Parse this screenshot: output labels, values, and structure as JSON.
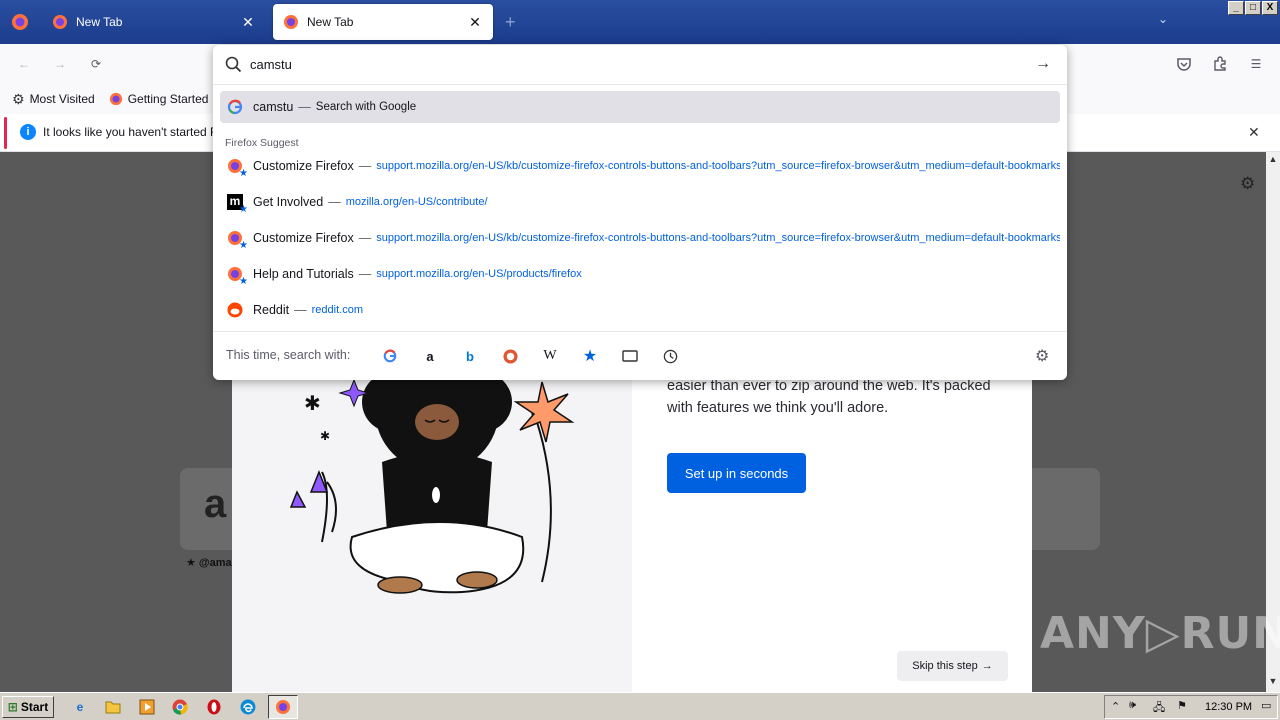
{
  "tabs": [
    {
      "title": "New Tab",
      "active": false
    },
    {
      "title": "New Tab",
      "active": true
    }
  ],
  "window_buttons": [
    "_",
    "□",
    "X"
  ],
  "bookmarks": [
    {
      "label": "Most Visited",
      "icon": "gear-icon"
    },
    {
      "label": "Getting Started",
      "icon": "firefox-icon"
    }
  ],
  "notice": {
    "text": "It looks like you haven't started Fire"
  },
  "urlbar": {
    "value": "camstu",
    "suggest_label": "Firefox Suggest",
    "first_row": {
      "term": "camstu",
      "action": "Search with Google"
    },
    "results": [
      {
        "title": "Customize Firefox",
        "url": "support.mozilla.org/en-US/kb/customize-firefox-controls-buttons-and-toolbars?utm_source=firefox-browser&utm_medium=default-bookmarks",
        "icon": "firefox-bookmark-icon"
      },
      {
        "title": "Get Involved",
        "url": "mozilla.org/en-US/contribute/",
        "icon": "mozilla-bookmark-icon"
      },
      {
        "title": "Customize Firefox",
        "url": "support.mozilla.org/en-US/kb/customize-firefox-controls-buttons-and-toolbars?utm_source=firefox-browser&utm_medium=default-bookmarks",
        "icon": "firefox-bookmark-icon"
      },
      {
        "title": "Help and Tutorials",
        "url": "support.mozilla.org/en-US/products/firefox",
        "icon": "firefox-bookmark-icon"
      },
      {
        "title": "Reddit",
        "url": "reddit.com",
        "icon": "reddit-icon"
      }
    ],
    "oneoff_label": "This time, search with:",
    "engines": [
      "google-icon",
      "amazon-icon",
      "bing-icon",
      "duckduckgo-icon",
      "wikipedia-icon",
      "bookmarks-icon",
      "tabs-icon",
      "history-icon"
    ]
  },
  "dialog": {
    "body": "easier than ever to zip around the web. It's packed with features we think you'll adore.",
    "primary_button": "Set up in seconds",
    "skip_button": "Skip this step"
  },
  "shortcut": {
    "label": "@ama"
  },
  "watermark": "ANY▷RUN",
  "taskbar": {
    "start": "Start",
    "time": "12:30 PM"
  },
  "colors": {
    "accent": "#0061e0",
    "tabstrip": "#1c3c8c",
    "url_link": "#0060df"
  }
}
